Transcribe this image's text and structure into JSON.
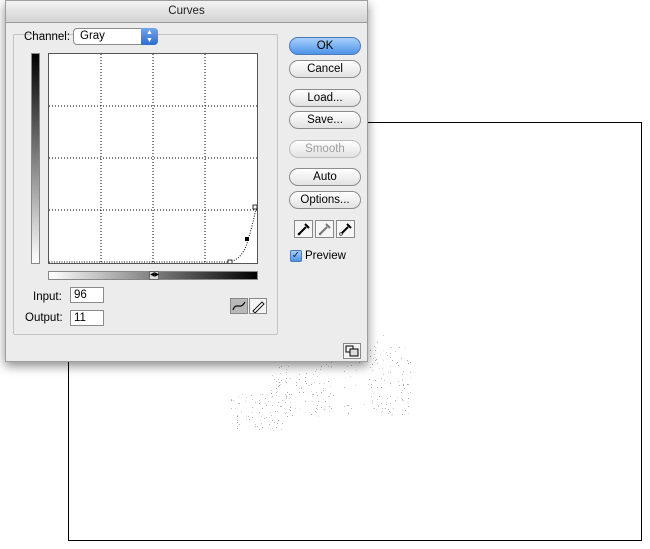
{
  "dialog": {
    "title": "Curves",
    "channel_label": "Channel:",
    "channel_value": "Gray",
    "input_label": "Input:",
    "input_value": "96",
    "output_label": "Output:",
    "output_value": "11",
    "buttons": {
      "ok": "OK",
      "cancel": "Cancel",
      "load": "Load...",
      "save": "Save...",
      "smooth": "Smooth",
      "auto": "Auto",
      "options": "Options..."
    },
    "preview_label": "Preview",
    "preview_checked": true,
    "icons": {
      "channel_arrows": "up-down-arrows-icon",
      "gradient_toggle": "gradient-direction-icon",
      "curve_tool": "curve-tool-icon",
      "pencil_tool": "pencil-tool-icon",
      "black_eyedropper": "black-eyedropper-icon",
      "gray_eyedropper": "gray-eyedropper-icon",
      "white_eyedropper": "white-eyedropper-icon",
      "expand": "expand-icon"
    }
  },
  "colors": {
    "default_button": "#4d93e8",
    "dialog_bg": "#ececec"
  }
}
